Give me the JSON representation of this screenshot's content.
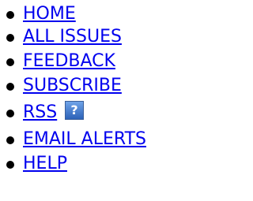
{
  "nav": {
    "items": [
      {
        "label": "HOME"
      },
      {
        "label": "ALL ISSUES"
      },
      {
        "label": "FEEDBACK"
      },
      {
        "label": "SUBSCRIBE"
      },
      {
        "label": "RSS"
      },
      {
        "label": "EMAIL ALERTS"
      },
      {
        "label": "HELP"
      }
    ],
    "rss_help_icon": {
      "icon": "help-icon",
      "glyph": "?"
    }
  },
  "colors": {
    "link": "#0000ee",
    "bullet": "#000000",
    "help_icon_bg": "#2c62b8"
  }
}
